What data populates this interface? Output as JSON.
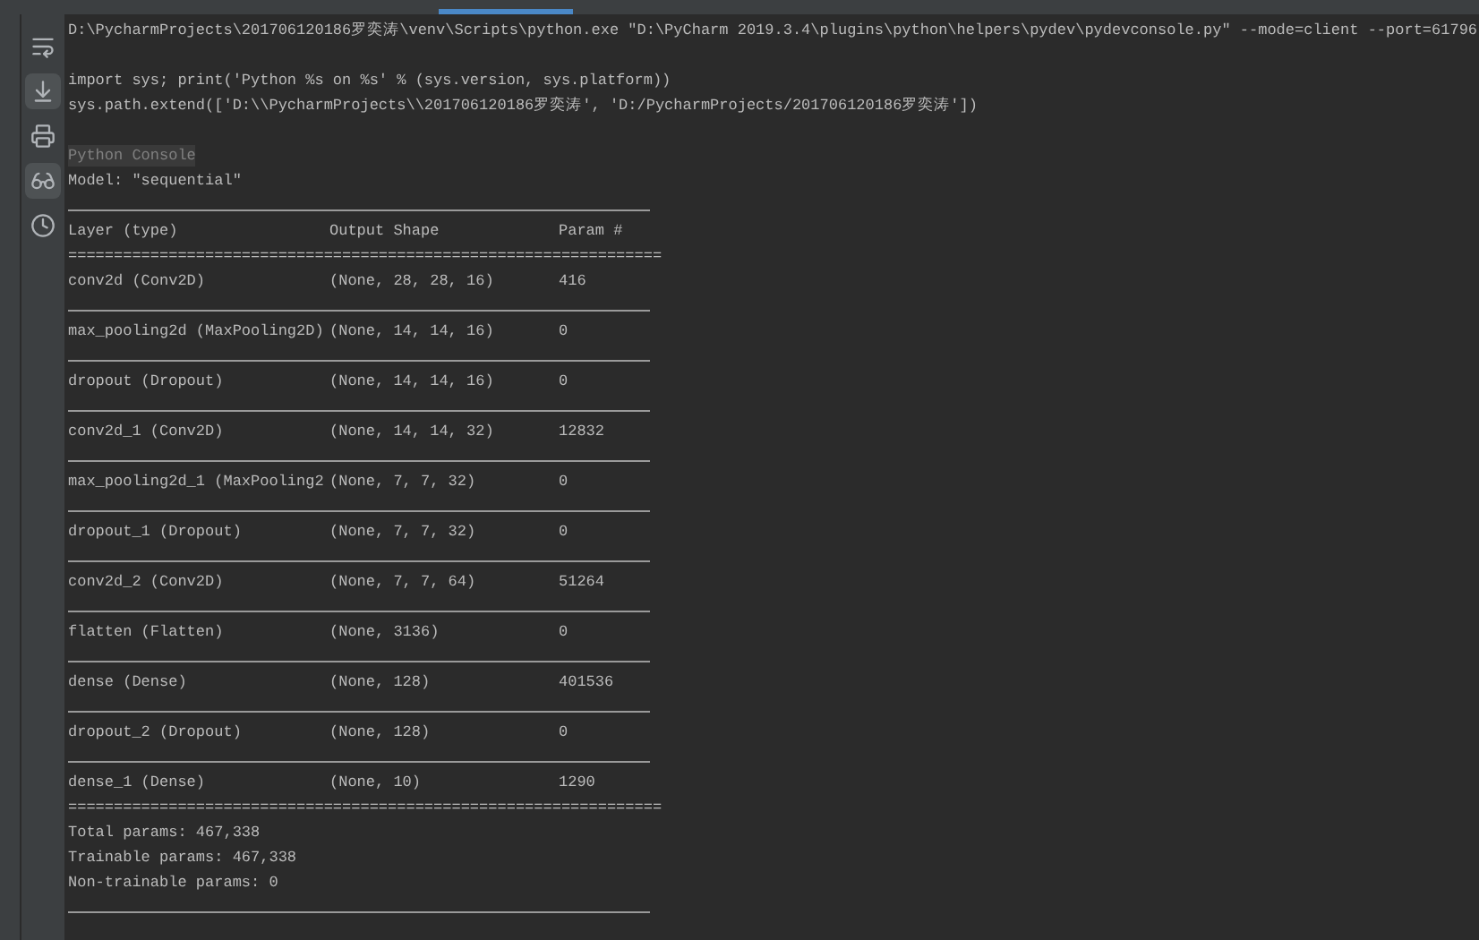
{
  "console": {
    "command_line": "D:\\PycharmProjects\\201706120186罗奕涛\\venv\\Scripts\\python.exe \"D:\\PyCharm 2019.3.4\\plugins\\python\\helpers\\pydev\\pydevconsole.py\" --mode=client --port=61796",
    "startup_lines": [
      "import sys; print('Python %s on %s' % (sys.version, sys.platform))",
      "sys.path.extend(['D:\\\\PycharmProjects\\\\201706120186罗奕涛', 'D:/PycharmProjects/201706120186罗奕涛'])"
    ],
    "banner": "Python Console",
    "model_line": "Model: \"sequential\"",
    "table": {
      "columns": [
        "Layer (type)",
        "Output Shape",
        "Param #"
      ],
      "separator": "=================================================================",
      "rows": [
        [
          "conv2d (Conv2D)",
          "(None, 28, 28, 16)",
          "416"
        ],
        [
          "max_pooling2d (MaxPooling2D)",
          "(None, 14, 14, 16)",
          "0"
        ],
        [
          "dropout (Dropout)",
          "(None, 14, 14, 16)",
          "0"
        ],
        [
          "conv2d_1 (Conv2D)",
          "(None, 14, 14, 32)",
          "12832"
        ],
        [
          "max_pooling2d_1 (MaxPooling2",
          "(None, 7, 7, 32)",
          "0"
        ],
        [
          "dropout_1 (Dropout)",
          "(None, 7, 7, 32)",
          "0"
        ],
        [
          "conv2d_2 (Conv2D)",
          "(None, 7, 7, 64)",
          "51264"
        ],
        [
          "flatten (Flatten)",
          "(None, 3136)",
          "0"
        ],
        [
          "dense (Dense)",
          "(None, 128)",
          "401536"
        ],
        [
          "dropout_2 (Dropout)",
          "(None, 128)",
          "0"
        ],
        [
          "dense_1 (Dense)",
          "(None, 10)",
          "1290"
        ]
      ],
      "closing_separator": "================================================================="
    },
    "summary": [
      "Total params: 467,338",
      "Trainable params: 467,338",
      "Non-trainable params: 0"
    ]
  }
}
